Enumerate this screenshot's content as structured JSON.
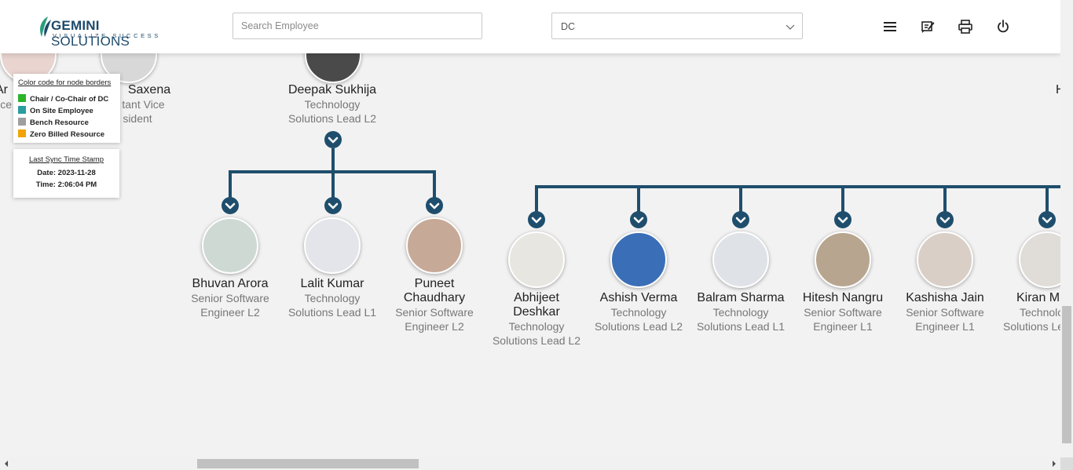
{
  "header": {
    "logo_main_bold": "GEMINI",
    "logo_main_rest": " SOLUTIONS",
    "logo_sub": "VISUALIZE SUCCESS",
    "search_placeholder": "Search Employee",
    "dept_select_value": "DC",
    "icons": [
      "menu-icon",
      "feedback-edit-icon",
      "print-icon",
      "power-icon"
    ]
  },
  "legend": {
    "title": "Color code for node borders",
    "items": [
      {
        "label": "Chair / Co-Chair of DC",
        "color": "#2bb32b"
      },
      {
        "label": "On Site Employee",
        "color": "#2a9d9d"
      },
      {
        "label": "Bench Resource",
        "color": "#9e9e9e"
      },
      {
        "label": "Zero Billed Resource",
        "color": "#f0a30a"
      }
    ]
  },
  "sync": {
    "title": "Last Sync Time Stamp",
    "date": "Date: 2023-11-28",
    "time": "Time: 2:06:04 PM"
  },
  "top_nodes": [
    {
      "name": "Ar",
      "title_line1": "ce",
      "title_line2": ""
    },
    {
      "name": "Saxena",
      "title_line1": "tant Vice",
      "title_line2": "sident"
    },
    {
      "name": "Deepak Sukhija",
      "title_line1": "Technology",
      "title_line2": "Solutions Lead L2"
    },
    {
      "name": "H",
      "title_line1": "",
      "title_line2": ""
    }
  ],
  "children_group1": [
    {
      "name_line1": "Bhuvan Arora",
      "name_line2": "",
      "title_line1": "Senior Software",
      "title_line2": "Engineer L2"
    },
    {
      "name_line1": "Lalit Kumar",
      "name_line2": "",
      "title_line1": "Technology",
      "title_line2": "Solutions Lead L1"
    },
    {
      "name_line1": "Puneet",
      "name_line2": "Chaudhary",
      "title_line1": "Senior Software",
      "title_line2": "Engineer L2"
    }
  ],
  "children_group2": [
    {
      "name_line1": "Abhijeet",
      "name_line2": "Deshkar",
      "title_line1": "Technology",
      "title_line2": "Solutions Lead L2"
    },
    {
      "name_line1": "Ashish Verma",
      "name_line2": "",
      "title_line1": "Technology",
      "title_line2": "Solutions Lead L2"
    },
    {
      "name_line1": "Balram Sharma",
      "name_line2": "",
      "title_line1": "Technology",
      "title_line2": "Solutions Lead L1"
    },
    {
      "name_line1": "Hitesh Nangru",
      "name_line2": "",
      "title_line1": "Senior Software",
      "title_line2": "Engineer L1"
    },
    {
      "name_line1": "Kashisha Jain",
      "name_line2": "",
      "title_line1": "Senior Software",
      "title_line2": "Engineer L1"
    },
    {
      "name_line1": "Kiran M",
      "name_line2": "",
      "title_line1": "Technolo",
      "title_line2": "Solutions Le"
    }
  ]
}
